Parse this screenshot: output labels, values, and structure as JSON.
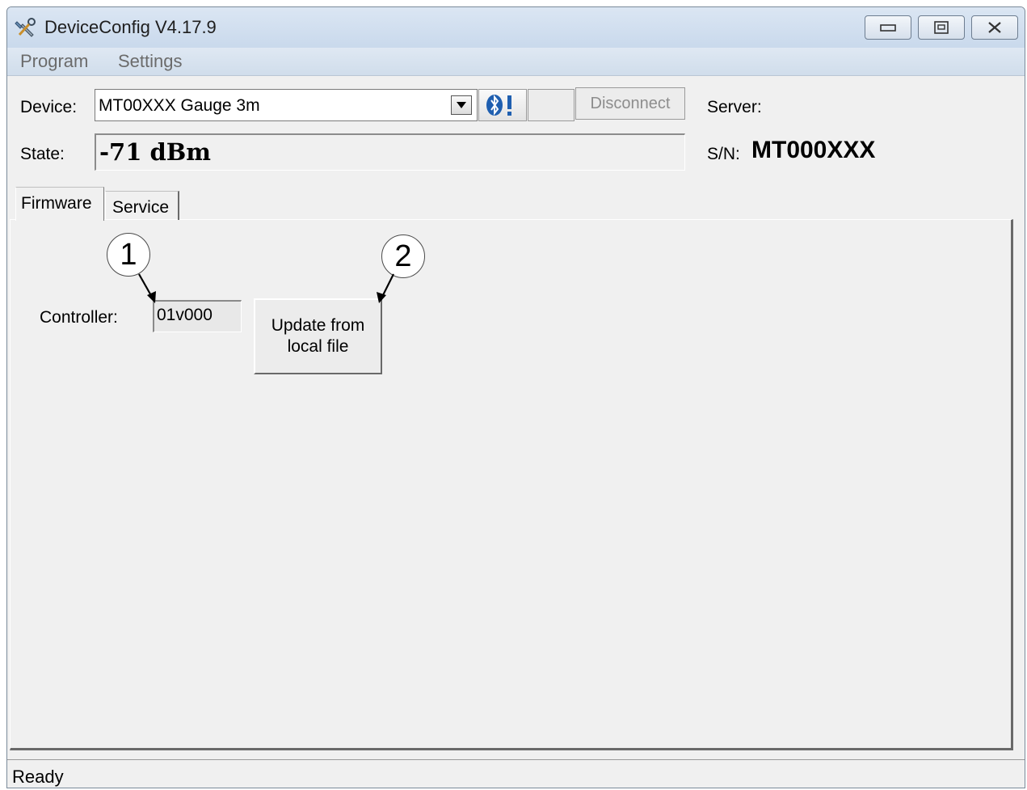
{
  "window": {
    "title": "DeviceConfig V4.17.9",
    "controls": [
      "minimize-icon",
      "maximize-icon",
      "close-icon"
    ]
  },
  "menu": {
    "items": [
      "Program",
      "Settings"
    ]
  },
  "device_row": {
    "label": "Device:",
    "selected": "MT00XXX Gauge 3m",
    "bluetooth_button": "bluetooth-warning-icon",
    "disconnect_label": "Disconnect"
  },
  "state_row": {
    "label": "State:",
    "value": "-71 dBm"
  },
  "server": {
    "label": "Server:",
    "value": ""
  },
  "serial": {
    "label": "S/N:",
    "value": "MT000XXX"
  },
  "tabs": [
    {
      "label": "Firmware",
      "active": true
    },
    {
      "label": "Service",
      "active": false
    }
  ],
  "firmware": {
    "controller_label": "Controller:",
    "controller_version": "01v000",
    "update_button": "Update from\nlocal file"
  },
  "callouts": [
    "1",
    "2"
  ],
  "status": {
    "text": "Ready"
  },
  "colors": {
    "titlebar": "#c9d9ec",
    "bluetooth": "#1f5fb0",
    "disabled_text": "#8d8d8d"
  }
}
